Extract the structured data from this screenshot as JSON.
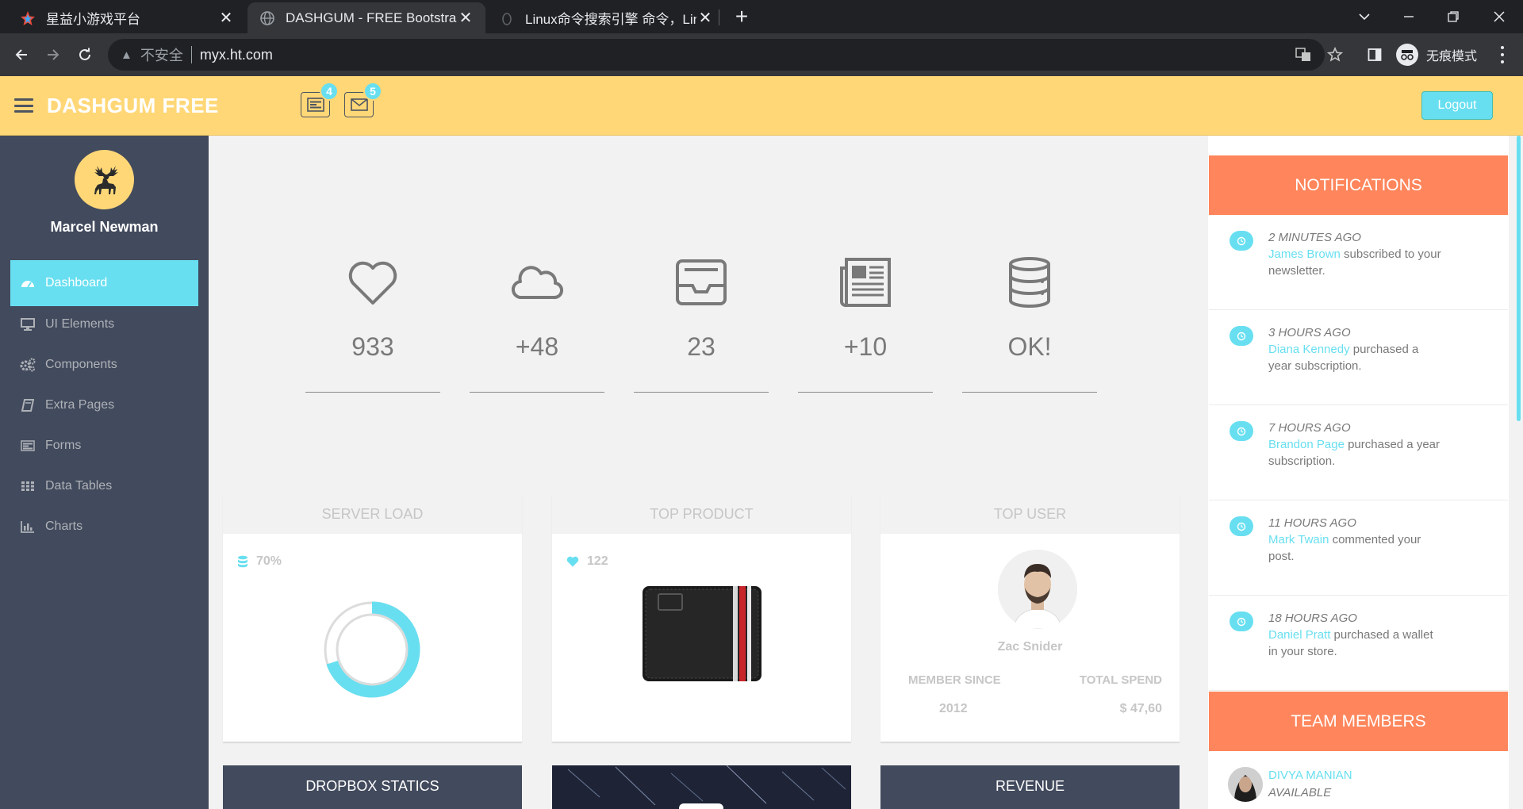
{
  "browser": {
    "tabs": [
      {
        "title": "星益小游戏平台",
        "active": false
      },
      {
        "title": "DASHGUM - FREE Bootstrap A",
        "active": true
      },
      {
        "title": "Linux命令搜索引擎 命令，Linux",
        "active": false
      }
    ],
    "security_label": "不安全",
    "url": "myx.ht.com",
    "incognito_label": "无痕模式"
  },
  "header": {
    "brand": "DASHGUM FREE",
    "tasks_badge": "4",
    "mail_badge": "5",
    "logout_label": "Logout"
  },
  "sidebar": {
    "user_name": "Marcel Newman",
    "items": [
      {
        "label": "Dashboard",
        "icon": "dashboard-icon",
        "active": true
      },
      {
        "label": "UI Elements",
        "icon": "desktop-icon"
      },
      {
        "label": "Components",
        "icon": "cogs-icon"
      },
      {
        "label": "Extra Pages",
        "icon": "book-icon"
      },
      {
        "label": "Forms",
        "icon": "tasks-icon"
      },
      {
        "label": "Data Tables",
        "icon": "table-icon"
      },
      {
        "label": "Charts",
        "icon": "bar-chart-icon"
      }
    ]
  },
  "stats": [
    {
      "icon": "heart-icon",
      "value": "933"
    },
    {
      "icon": "cloud-icon",
      "value": "+48"
    },
    {
      "icon": "inbox-icon",
      "value": "23"
    },
    {
      "icon": "newspaper-icon",
      "value": "+10"
    },
    {
      "icon": "database-icon",
      "value": "OK!"
    }
  ],
  "server_load": {
    "title": "SERVER LOAD",
    "value_label": "70%",
    "percent": 70
  },
  "top_product": {
    "title": "TOP PRODUCT",
    "likes": "122"
  },
  "top_user": {
    "title": "TOP USER",
    "name": "Zac Snider",
    "member_since_label": "MEMBER SINCE",
    "total_spend_label": "TOTAL SPEND",
    "member_since": "2012",
    "total_spend": "$ 47,60"
  },
  "bottom_cards": {
    "dropbox": "DROPBOX STATICS",
    "revenue": "REVENUE"
  },
  "notifications": {
    "title": "NOTIFICATIONS",
    "items": [
      {
        "time": "2 MINUTES AGO",
        "name": "James Brown",
        "text": " subscribed to your newsletter."
      },
      {
        "time": "3 HOURS AGO",
        "name": "Diana Kennedy",
        "text": " purchased a year subscription."
      },
      {
        "time": "7 HOURS AGO",
        "name": "Brandon Page",
        "text": " purchased a year subscription."
      },
      {
        "time": "11 HOURS AGO",
        "name": "Mark Twain",
        "text": " commented your post."
      },
      {
        "time": "18 HOURS AGO",
        "name": "Daniel Pratt",
        "text": " purchased a wallet in your store."
      }
    ]
  },
  "team": {
    "title": "TEAM MEMBERS",
    "members": [
      {
        "name": "DIVYA MANIAN",
        "status": "AVAILABLE"
      }
    ]
  },
  "colors": {
    "accent": "#68dff0",
    "header": "#ffd777",
    "sidebar": "#424a5d",
    "orange": "#ff865c"
  }
}
